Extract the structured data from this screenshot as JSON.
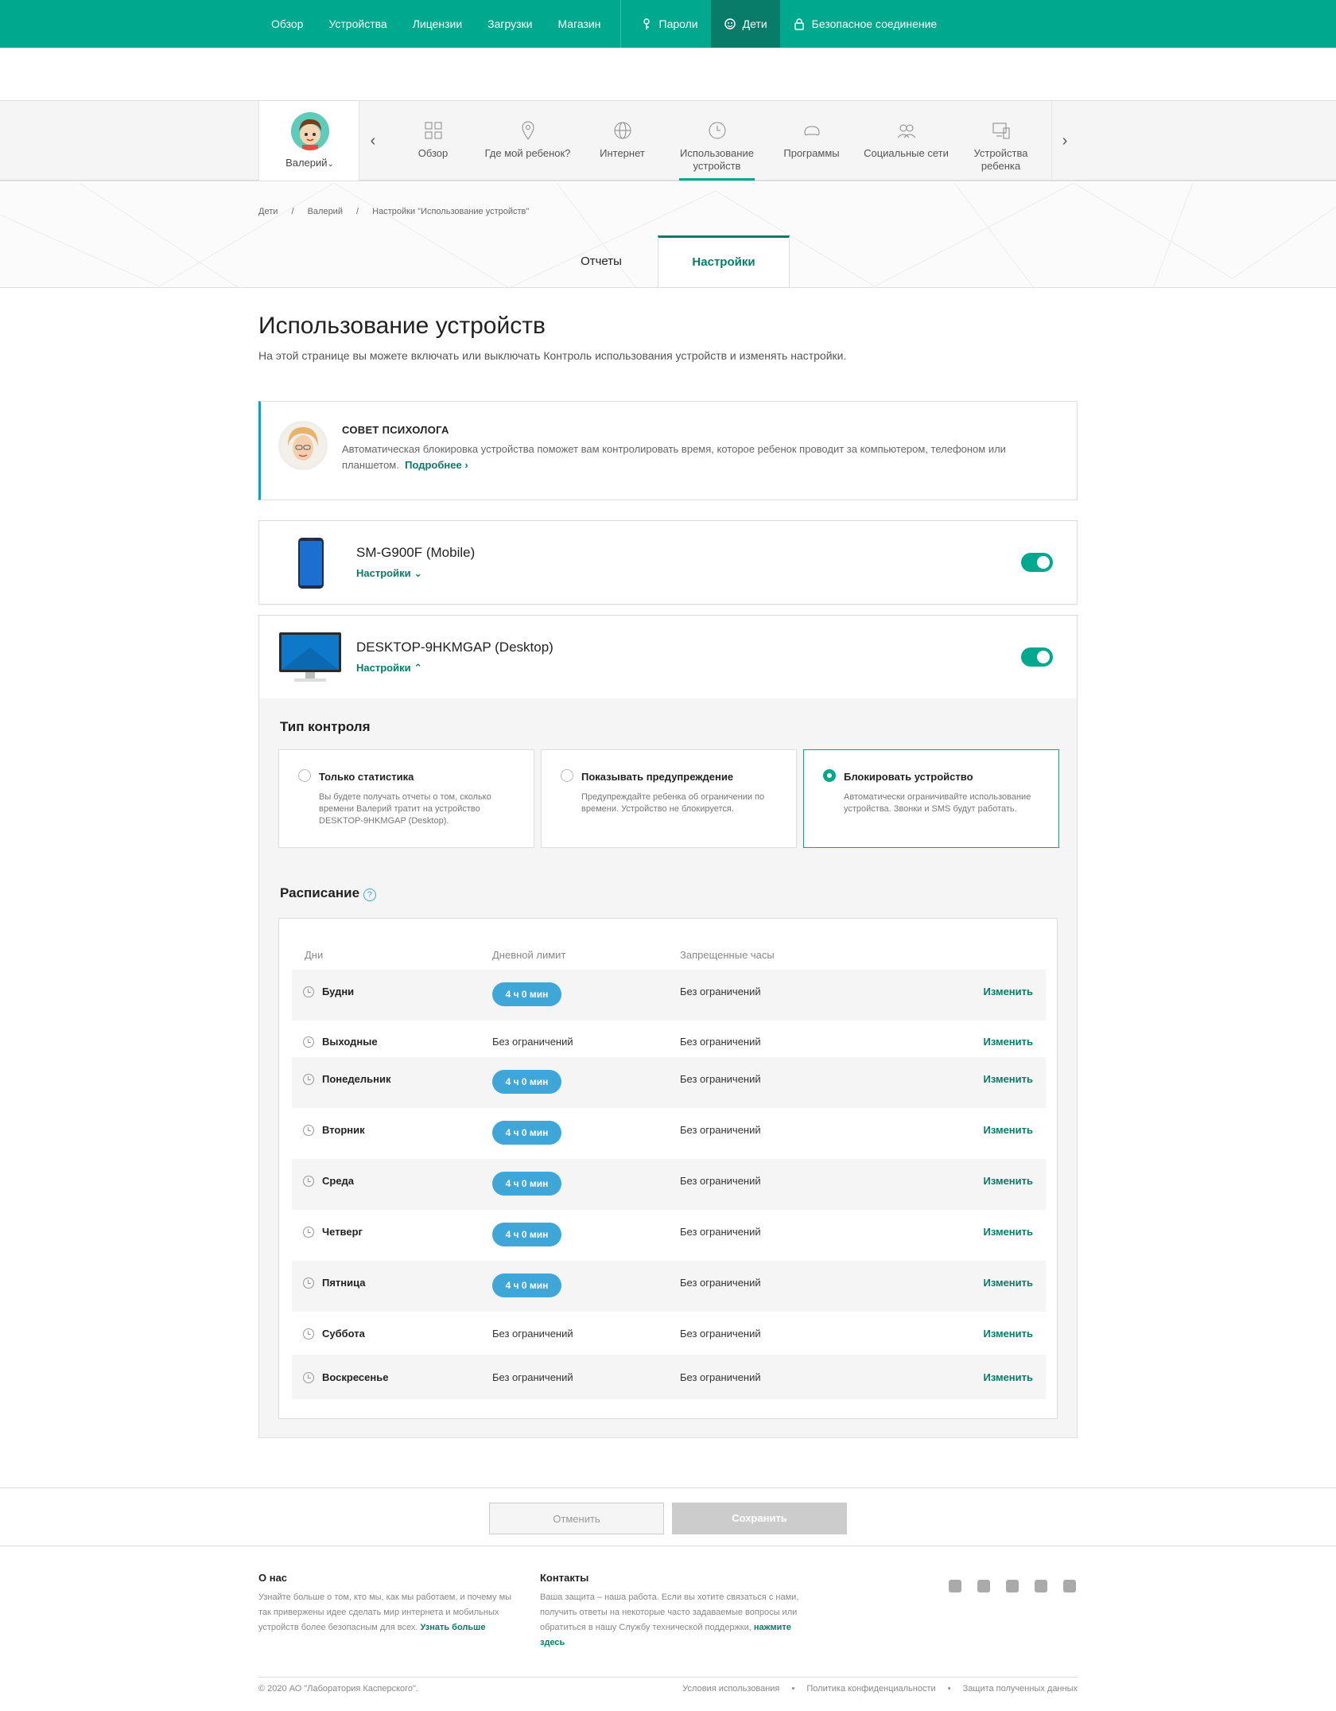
{
  "topnav": {
    "items": [
      "Обзор",
      "Устройства",
      "Лицензии",
      "Загрузки",
      "Магазин"
    ],
    "passwords": "Пароли",
    "kids": "Дети",
    "secure": "Безопасное соединение"
  },
  "child": {
    "name": "Валерий"
  },
  "childnav": [
    {
      "label": "Обзор",
      "icon": "overview-icon"
    },
    {
      "label": "Где мой ребенок?",
      "icon": "location-pin-icon"
    },
    {
      "label": "Интернет",
      "icon": "globe-icon"
    },
    {
      "label": "Использование устройств",
      "icon": "clock-icon"
    },
    {
      "label": "Программы",
      "icon": "gamepad-icon"
    },
    {
      "label": "Социальные сети",
      "icon": "people-icon"
    },
    {
      "label": "Устройства ребенка",
      "icon": "devices-icon"
    }
  ],
  "breadcrumb": [
    "Дети",
    "Валерий",
    "Настройки \"Использование устройств\""
  ],
  "tabs": {
    "reports": "Отчеты",
    "settings": "Настройки"
  },
  "page": {
    "title": "Использование устройств",
    "subtitle": "На этой странице вы можете включать или выключать Контроль использования устройств и изменять настройки."
  },
  "tip": {
    "title": "СОВЕТ ПСИХОЛОГА",
    "text": "Автоматическая блокировка устройства поможет вам контролировать время, которое ребенок проводит за компьютером, телефоном или планшетом.",
    "more": "Подробнее"
  },
  "devices": [
    {
      "name": "SM-G900F (Mobile)",
      "settings": "Настройки",
      "enabled": true
    },
    {
      "name": "DESKTOP-9HKMGAP (Desktop)",
      "settings": "Настройки",
      "enabled": true
    }
  ],
  "control": {
    "title": "Тип контроля",
    "options": [
      {
        "title": "Только статистика",
        "desc": "Вы будете получать отчеты о том, сколько времени Валерий тратит на устройство DESKTOP-9HKMGAP (Desktop).",
        "selected": false
      },
      {
        "title": "Показывать предупреждение",
        "desc": "Предупреждайте ребенка об ограничении по времени. Устройство не блокируется.",
        "selected": false
      },
      {
        "title": "Блокировать устройство",
        "desc": "Автоматически ограничивайте использование устройства. Звонки и SMS будут работать.",
        "selected": true
      }
    ]
  },
  "schedule": {
    "title": "Расписание",
    "headers": {
      "days": "Дни",
      "limit": "Дневной лимит",
      "forbidden": "Запрещенные часы"
    },
    "change": "Изменить",
    "rows": [
      {
        "day": "Будни",
        "limit": "4 ч 0 мин",
        "pill": true,
        "forbidden": "Без ограничений"
      },
      {
        "day": "Выходные",
        "limit": "Без ограничений",
        "pill": false,
        "forbidden": "Без ограничений"
      },
      {
        "day": "Понедельник",
        "limit": "4 ч 0 мин",
        "pill": true,
        "forbidden": "Без ограничений"
      },
      {
        "day": "Вторник",
        "limit": "4 ч 0 мин",
        "pill": true,
        "forbidden": "Без ограничений"
      },
      {
        "day": "Среда",
        "limit": "4 ч 0 мин",
        "pill": true,
        "forbidden": "Без ограничений"
      },
      {
        "day": "Четверг",
        "limit": "4 ч 0 мин",
        "pill": true,
        "forbidden": "Без ограничений"
      },
      {
        "day": "Пятница",
        "limit": "4 ч 0 мин",
        "pill": true,
        "forbidden": "Без ограничений"
      },
      {
        "day": "Суббота",
        "limit": "Без ограничений",
        "pill": false,
        "forbidden": "Без ограничений"
      },
      {
        "day": "Воскресенье",
        "limit": "Без ограничений",
        "pill": false,
        "forbidden": "Без ограничений"
      }
    ]
  },
  "actions": {
    "cancel": "Отменить",
    "save": "Сохранить"
  },
  "footer": {
    "about_title": "О нас",
    "about_text": "Узнайте больше о том, кто мы, как мы работаем, и почему мы так привержены идее сделать мир интернета и мобильных устройств более безопасным для всех.",
    "about_link": "Узнать больше",
    "contacts_title": "Контакты",
    "contacts_text": "Ваша защита – наша работа. Если вы хотите связаться с нами, получить ответы на некоторые часто задаваемые вопросы или обратиться в нашу Службу технической поддержки,",
    "contacts_link": "нажмите здесь",
    "copyright": "© 2020 АО \"Лаборатория Касперского\".",
    "links": [
      "Условия использования",
      "Политика конфиденциальности",
      "Защита полученных данных"
    ],
    "social": [
      "facebook-icon",
      "instagram-icon",
      "youtube-icon",
      "linkedin-icon",
      "twitter-icon"
    ]
  },
  "colors": {
    "brand": "#00a88e",
    "brand_dark": "#087c68",
    "pill": "#3ea7d8",
    "tip_accent": "#00a3e0"
  }
}
